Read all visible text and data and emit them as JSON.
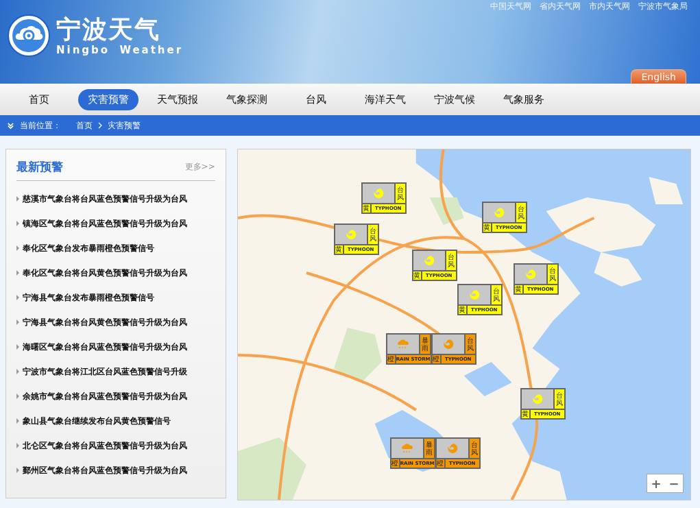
{
  "top_links": [
    "中国天气网",
    "省内天气网",
    "市内天气网",
    "宁波市气象局"
  ],
  "site": {
    "title": "宁波天气",
    "subtitle": "Ningbo Weather"
  },
  "language_button": "English",
  "nav": [
    {
      "label": "首页",
      "selected": false
    },
    {
      "label": "灾害预警",
      "selected": true
    },
    {
      "label": "天气预报",
      "selected": false
    },
    {
      "label": "气象探测",
      "selected": false
    },
    {
      "label": "台风",
      "selected": false
    },
    {
      "label": "海洋天气",
      "selected": false
    },
    {
      "label": "宁波气候",
      "selected": false
    },
    {
      "label": "气象服务",
      "selected": false
    }
  ],
  "breadcrumb": {
    "label": "当前位置：",
    "items": [
      "首页",
      "灾害预警"
    ]
  },
  "warnings_panel": {
    "title": "最新预警",
    "more": "更多>>",
    "items": [
      "慈溪市气象台将台风蓝色预警信号升级为台风",
      "镇海区气象台将台风蓝色预警信号升级为台风",
      "奉化区气象台发布暴雨橙色预警信号",
      "奉化区气象台将台风黄色预警信号升级为台风",
      "宁海县气象台发布暴雨橙色预警信号",
      "宁海县气象台将台风黄色预警信号升级为台风",
      "海曙区气象台将台风蓝色预警信号升级为台风",
      "宁波市气象台将江北区台风蓝色预警信号升级",
      "余姚市气象台将台风蓝色预警信号升级为台风",
      "象山县气象台继续发布台风黄色预警信号",
      "北仑区气象台将台风蓝色预警信号升级为台风",
      "鄞州区气象台将台风蓝色预警信号升级为台风"
    ]
  },
  "map": {
    "markers": [
      {
        "signs": [
          {
            "kind": "typhoon",
            "color": "#ffff00",
            "name": "台风",
            "level_char": "黄",
            "english": "TYPHOON"
          }
        ]
      },
      {
        "signs": [
          {
            "kind": "typhoon",
            "color": "#ffff00",
            "name": "台风",
            "level_char": "黄",
            "english": "TYPHOON"
          }
        ]
      },
      {
        "signs": [
          {
            "kind": "typhoon",
            "color": "#ffff00",
            "name": "台风",
            "level_char": "黄",
            "english": "TYPHOON"
          }
        ]
      },
      {
        "signs": [
          {
            "kind": "typhoon",
            "color": "#ffff00",
            "name": "台风",
            "level_char": "黄",
            "english": "TYPHOON"
          }
        ]
      },
      {
        "signs": [
          {
            "kind": "typhoon",
            "color": "#ffff00",
            "name": "台风",
            "level_char": "黄",
            "english": "TYPHOON"
          }
        ]
      },
      {
        "signs": [
          {
            "kind": "typhoon",
            "color": "#ffff00",
            "name": "台风",
            "level_char": "黄",
            "english": "TYPHOON"
          }
        ]
      },
      {
        "signs": [
          {
            "kind": "rainstorm",
            "color": "#f39800",
            "name": "暴雨",
            "level_char": "橙",
            "english": "RAIN STORM"
          },
          {
            "kind": "typhoon",
            "color": "#f39800",
            "name": "台风",
            "level_char": "橙",
            "english": "TYPHOON"
          }
        ]
      },
      {
        "signs": [
          {
            "kind": "typhoon",
            "color": "#ffff00",
            "name": "台风",
            "level_char": "黄",
            "english": "TYPHOON"
          }
        ]
      },
      {
        "signs": [
          {
            "kind": "rainstorm",
            "color": "#f39800",
            "name": "暴雨",
            "level_char": "橙",
            "english": "RAIN STORM"
          },
          {
            "kind": "typhoon",
            "color": "#f39800",
            "name": "台风",
            "level_char": "橙",
            "english": "TYPHOON"
          }
        ]
      }
    ],
    "zoom_in": "+",
    "zoom_out": "−"
  }
}
